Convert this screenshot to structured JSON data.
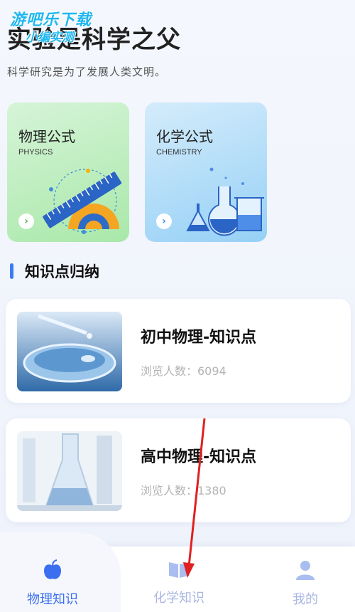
{
  "watermark": {
    "line1": "游吧乐下载",
    "line2": "小编实测"
  },
  "header": {
    "title": "实验是科学之父",
    "subtitle": "科学研究是为了发展人类文明。"
  },
  "categories": [
    {
      "title": "物理公式",
      "subtitle": "PHYSICS",
      "arrow": "›",
      "icon": "ruler-protractor-illustration",
      "color": "#a9e8a9"
    },
    {
      "title": "化学公式",
      "subtitle": "CHEMISTRY",
      "arrow": "›",
      "icon": "flasks-illustration",
      "color": "#96d0f6"
    }
  ],
  "section": {
    "title": "知识点归纳",
    "accent": "#3b7cf5"
  },
  "knowledge": [
    {
      "title": "初中物理-知识点",
      "views": "浏览人数：6094",
      "image": "petri-dish-photo"
    },
    {
      "title": "高中物理-知识点",
      "views": "浏览人数：1380",
      "image": "lab-flask-photo"
    }
  ],
  "tabbar": {
    "tabs": [
      {
        "label": "物理知识",
        "icon": "apple-icon",
        "active": true
      },
      {
        "label": "化学知识",
        "icon": "book-icon",
        "active": false
      },
      {
        "label": "我的",
        "icon": "user-icon",
        "active": false
      }
    ],
    "active_color": "#3b6ff0",
    "inactive_color": "#a9b6e2"
  },
  "annotation": {
    "color": "#e02020",
    "meaning": "red-arrow-pointing-to-chemistry-tab"
  }
}
